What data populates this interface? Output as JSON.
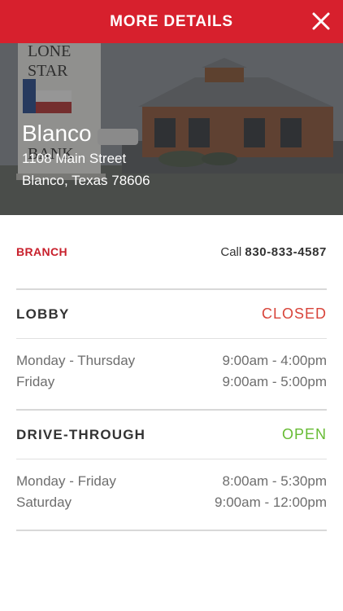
{
  "header": {
    "title": "MORE DETAILS",
    "close_icon": "close-icon"
  },
  "hero": {
    "branch_name": "Blanco",
    "address_line1": "1108 Main Street",
    "address_line2": "Blanco, Texas 78606",
    "sign_text_1": "LONE",
    "sign_text_2": "STAR",
    "sign_text_3": "BANK"
  },
  "branch": {
    "label": "BRANCH",
    "call_prefix": "Call",
    "phone": "830-833-4587"
  },
  "lobby": {
    "title": "LOBBY",
    "status": "CLOSED",
    "hours": [
      {
        "day": "Monday - Thursday",
        "time": "9:00am - 4:00pm"
      },
      {
        "day": "Friday",
        "time": "9:00am - 5:00pm"
      }
    ]
  },
  "drive_through": {
    "title": "DRIVE-THROUGH",
    "status": "OPEN",
    "hours": [
      {
        "day": "Monday - Friday",
        "time": "8:00am - 5:30pm"
      },
      {
        "day": "Saturday",
        "time": "9:00am - 12:00pm"
      }
    ]
  },
  "colors": {
    "brand_red": "#d7202d",
    "closed": "#d8443a",
    "open": "#66bb33"
  }
}
